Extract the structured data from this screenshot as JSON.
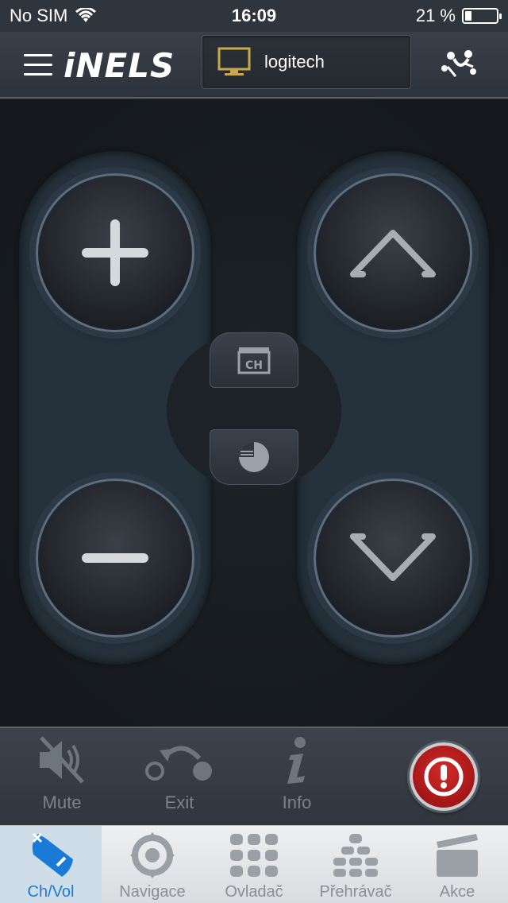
{
  "status_bar": {
    "carrier": "No SIM",
    "time": "16:09",
    "battery_text": "21 %",
    "battery_level": 0.21
  },
  "header": {
    "logo": "iNELS",
    "device_name": "logitech"
  },
  "controls": {
    "mute_label": "Mute",
    "exit_label": "Exit",
    "info_label": "Info"
  },
  "tabs": [
    {
      "label": "Ch/Vol",
      "icon": "ch-vol-icon",
      "active": true
    },
    {
      "label": "Navigace",
      "icon": "navigation-dpad-icon",
      "active": false
    },
    {
      "label": "Ovladač",
      "icon": "keypad-icon",
      "active": false
    },
    {
      "label": "Přehrávač",
      "icon": "player-icon",
      "active": false
    },
    {
      "label": "Akce",
      "icon": "clapperboard-icon",
      "active": false
    }
  ],
  "colors": {
    "active_tab": "#1a7ad8",
    "power": "#c41a1a"
  }
}
